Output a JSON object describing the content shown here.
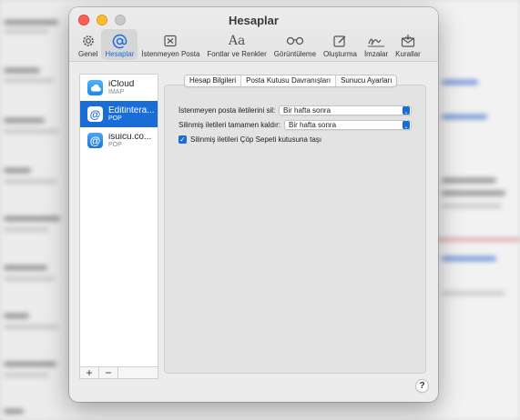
{
  "window": {
    "title": "Hesaplar"
  },
  "toolbar": {
    "items": [
      {
        "label": "Genel",
        "icon": "gear-icon"
      },
      {
        "label": "Hesaplar",
        "icon": "at-icon"
      },
      {
        "label": "İstenmeyen Posta",
        "icon": "junk-tray-icon"
      },
      {
        "label": "Fontlar ve Renkler",
        "icon": "font-aa-icon"
      },
      {
        "label": "Görüntüleme",
        "icon": "glasses-icon"
      },
      {
        "label": "Oluşturma",
        "icon": "compose-icon"
      },
      {
        "label": "İmzalar",
        "icon": "signature-icon"
      },
      {
        "label": "Kurallar",
        "icon": "rules-envelope-icon"
      }
    ],
    "active_index": 1
  },
  "accounts": [
    {
      "name": "iCloud",
      "type": "IMAP",
      "icon": "icloud-icon",
      "selected": false
    },
    {
      "name": "Editintera...",
      "type": "POP",
      "icon": "at-icon",
      "selected": true
    },
    {
      "name": "isuicu.co...",
      "type": "POP",
      "icon": "at-icon",
      "selected": false
    }
  ],
  "list_buttons": {
    "add": "+",
    "remove": "−"
  },
  "tabs": [
    {
      "label": "Hesap Bilgileri",
      "active": false
    },
    {
      "label": "Posta Kutusu Davranışları",
      "active": true
    },
    {
      "label": "Sunucu Ayarları",
      "active": false
    }
  ],
  "settings": {
    "junk_delete_label": "İstenmeyen posta iletilerini sil:",
    "junk_delete_value": "Bir hafta sonra",
    "deleted_erase_label": "Silinmiş iletileri tamamen kaldır:",
    "deleted_erase_value": "Bir hafta sonra",
    "move_to_trash_label": "Silinmiş iletileri Çöp Sepeti kutusuna taşı",
    "move_to_trash_checked": true
  },
  "help_button": "?",
  "colors": {
    "accent": "#1a6cd6",
    "close": "#ff5f57",
    "minimize": "#febc2e"
  }
}
